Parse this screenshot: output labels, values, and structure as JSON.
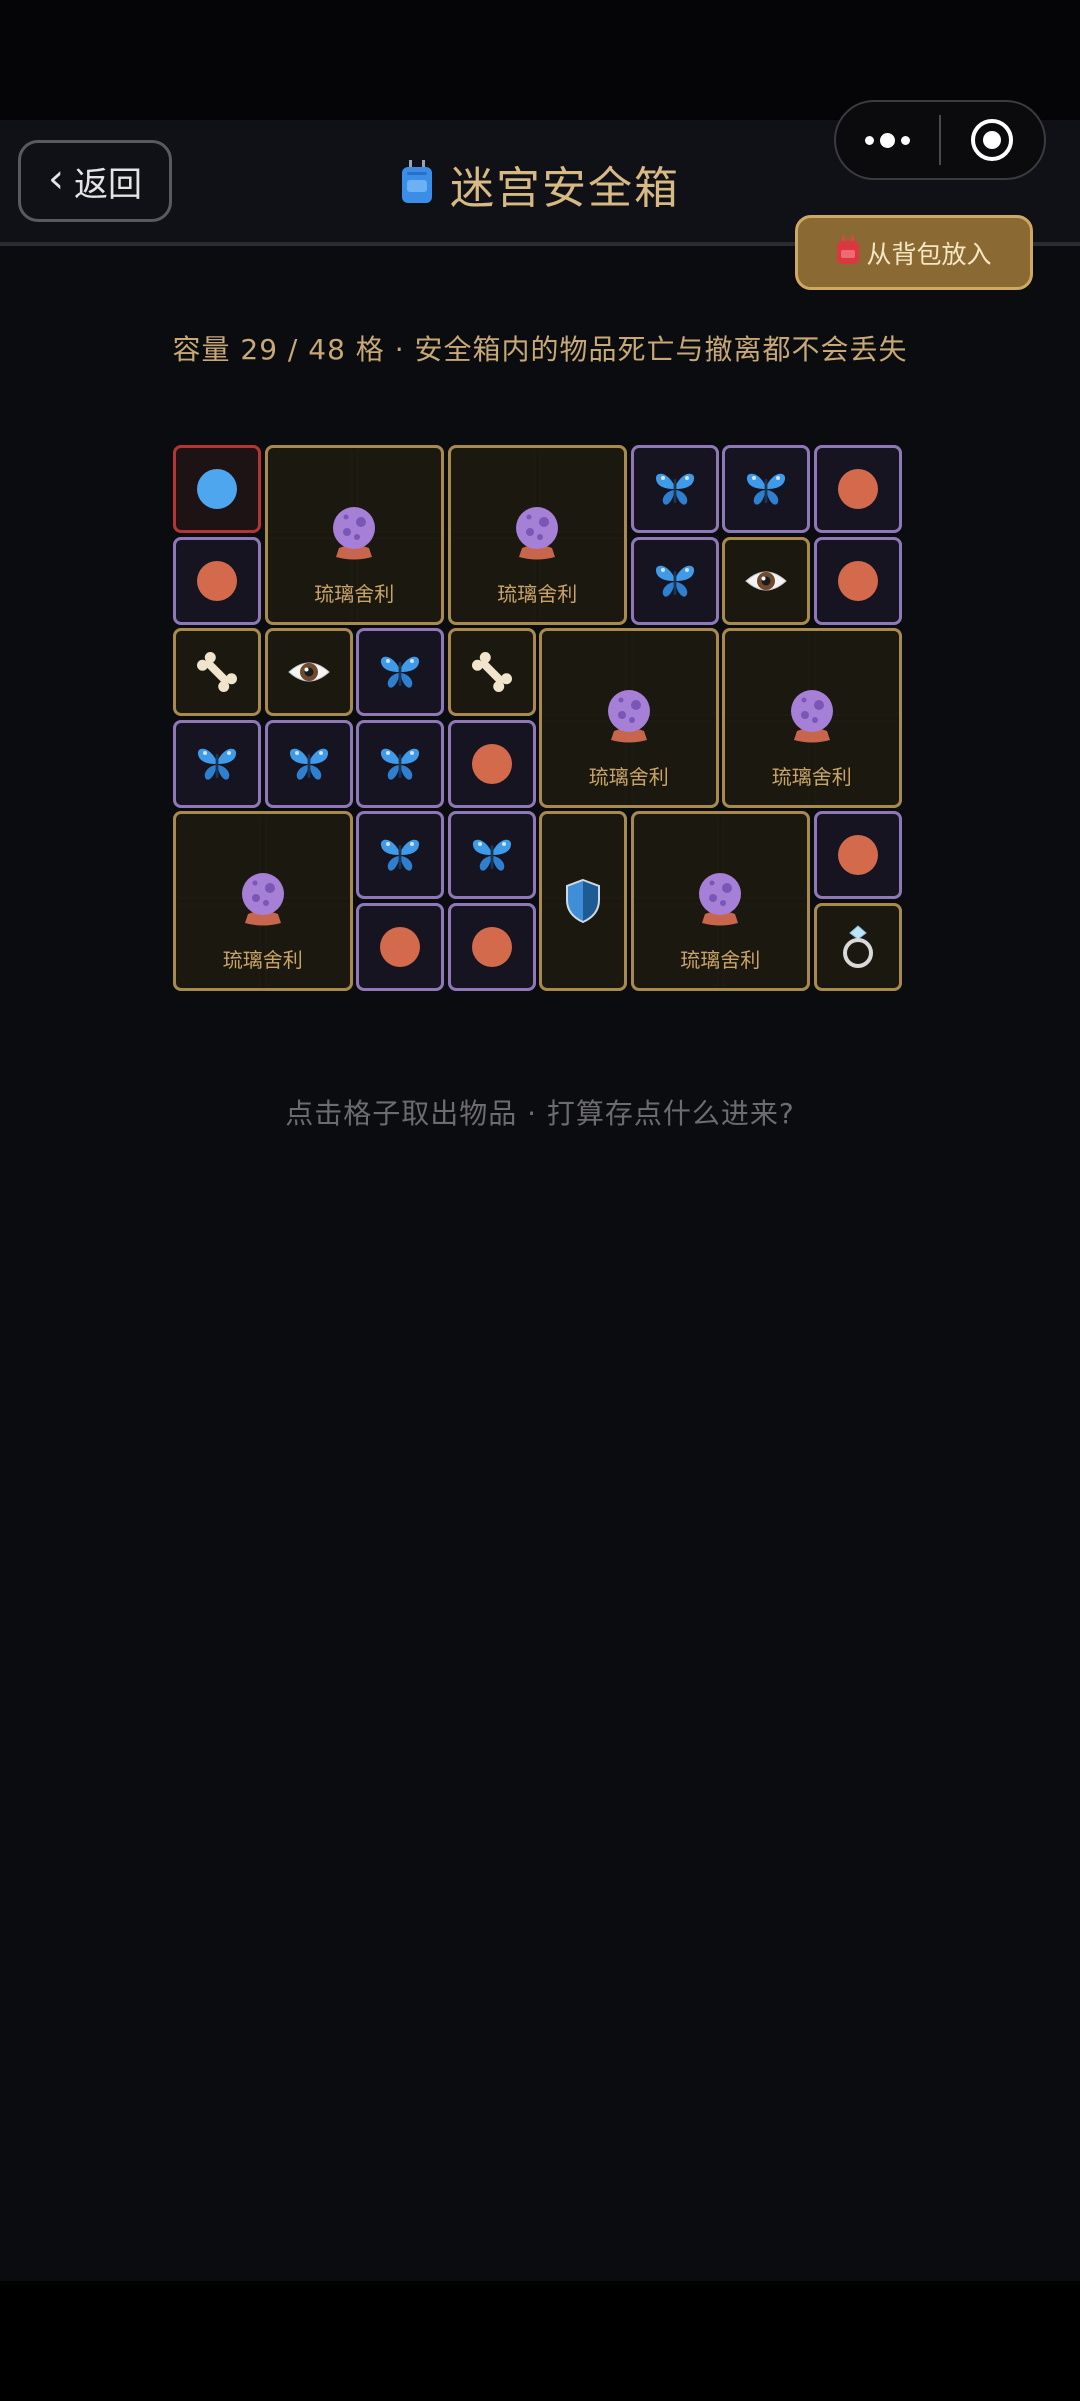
{
  "nav": {
    "back_label": "返回",
    "back_chevron": "‹",
    "title": "迷宫安全箱",
    "title_icon": "backpack-icon",
    "put_button_label": "从背包放入",
    "put_button_icon": "backpack-icon"
  },
  "capsule": {
    "more_icon": "more-dots-icon",
    "close_icon": "mini-program-close-icon"
  },
  "capacity_text": "容量 29 / 48 格 · 安全箱内的物品死亡与撤离都不会丢失",
  "hint_text": "点击格子取出物品 · 打算存点什么进来?",
  "grid": {
    "cols": 8,
    "rows": 6,
    "items": [
      {
        "row": 0,
        "col": 0,
        "w": 1,
        "h": 1,
        "icon": "blue-orb",
        "rarity": "red"
      },
      {
        "row": 0,
        "col": 1,
        "w": 2,
        "h": 2,
        "icon": "crystal-ball",
        "rarity": "gold",
        "label": "琉璃舍利"
      },
      {
        "row": 0,
        "col": 3,
        "w": 2,
        "h": 2,
        "icon": "crystal-ball",
        "rarity": "gold",
        "label": "琉璃舍利"
      },
      {
        "row": 0,
        "col": 5,
        "w": 1,
        "h": 1,
        "icon": "butterfly",
        "rarity": "purple"
      },
      {
        "row": 0,
        "col": 6,
        "w": 1,
        "h": 1,
        "icon": "butterfly",
        "rarity": "purple"
      },
      {
        "row": 0,
        "col": 7,
        "w": 1,
        "h": 1,
        "icon": "orange-orb",
        "rarity": "purple"
      },
      {
        "row": 1,
        "col": 0,
        "w": 1,
        "h": 1,
        "icon": "orange-orb",
        "rarity": "purple"
      },
      {
        "row": 1,
        "col": 5,
        "w": 1,
        "h": 1,
        "icon": "butterfly",
        "rarity": "purple"
      },
      {
        "row": 1,
        "col": 6,
        "w": 1,
        "h": 1,
        "icon": "eye",
        "rarity": "gold"
      },
      {
        "row": 1,
        "col": 7,
        "w": 1,
        "h": 1,
        "icon": "orange-orb",
        "rarity": "purple"
      },
      {
        "row": 2,
        "col": 0,
        "w": 1,
        "h": 1,
        "icon": "bone",
        "rarity": "gold"
      },
      {
        "row": 2,
        "col": 1,
        "w": 1,
        "h": 1,
        "icon": "eye",
        "rarity": "gold"
      },
      {
        "row": 2,
        "col": 2,
        "w": 1,
        "h": 1,
        "icon": "butterfly",
        "rarity": "purple"
      },
      {
        "row": 2,
        "col": 3,
        "w": 1,
        "h": 1,
        "icon": "bone",
        "rarity": "gold"
      },
      {
        "row": 2,
        "col": 4,
        "w": 2,
        "h": 2,
        "icon": "crystal-ball",
        "rarity": "gold",
        "label": "琉璃舍利"
      },
      {
        "row": 2,
        "col": 6,
        "w": 2,
        "h": 2,
        "icon": "crystal-ball",
        "rarity": "gold",
        "label": "琉璃舍利"
      },
      {
        "row": 3,
        "col": 0,
        "w": 1,
        "h": 1,
        "icon": "butterfly",
        "rarity": "purple"
      },
      {
        "row": 3,
        "col": 1,
        "w": 1,
        "h": 1,
        "icon": "butterfly",
        "rarity": "purple"
      },
      {
        "row": 3,
        "col": 2,
        "w": 1,
        "h": 1,
        "icon": "butterfly",
        "rarity": "purple"
      },
      {
        "row": 3,
        "col": 3,
        "w": 1,
        "h": 1,
        "icon": "orange-orb",
        "rarity": "purple"
      },
      {
        "row": 4,
        "col": 0,
        "w": 2,
        "h": 2,
        "icon": "crystal-ball",
        "rarity": "gold",
        "label": "琉璃舍利"
      },
      {
        "row": 4,
        "col": 2,
        "w": 1,
        "h": 1,
        "icon": "butterfly",
        "rarity": "purple"
      },
      {
        "row": 4,
        "col": 3,
        "w": 1,
        "h": 1,
        "icon": "butterfly",
        "rarity": "purple"
      },
      {
        "row": 4,
        "col": 4,
        "w": 1,
        "h": 2,
        "icon": "shield",
        "rarity": "gold"
      },
      {
        "row": 4,
        "col": 5,
        "w": 2,
        "h": 2,
        "icon": "crystal-ball",
        "rarity": "gold",
        "label": "琉璃舍利"
      },
      {
        "row": 4,
        "col": 7,
        "w": 1,
        "h": 1,
        "icon": "orange-orb",
        "rarity": "purple"
      },
      {
        "row": 5,
        "col": 2,
        "w": 1,
        "h": 1,
        "icon": "orange-orb",
        "rarity": "purple"
      },
      {
        "row": 5,
        "col": 3,
        "w": 1,
        "h": 1,
        "icon": "orange-orb",
        "rarity": "purple"
      },
      {
        "row": 5,
        "col": 7,
        "w": 1,
        "h": 1,
        "icon": "ring",
        "rarity": "gold"
      }
    ]
  },
  "colors": {
    "accent_gold": "#d7b983",
    "rarity_gold": "#a88a4c",
    "rarity_purple": "#8e78b8",
    "rarity_red": "#b63434",
    "background": "#0b0c10"
  }
}
